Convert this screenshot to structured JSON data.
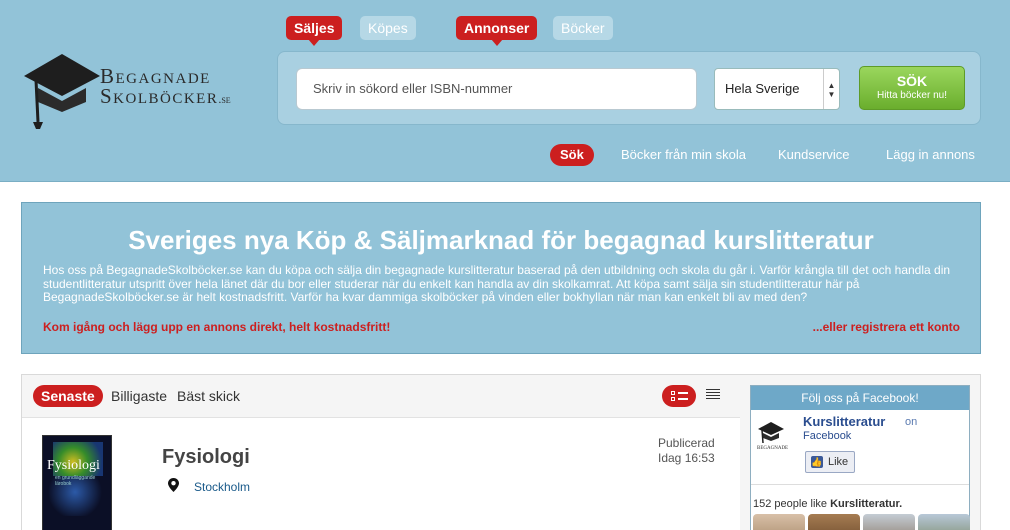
{
  "header": {
    "logo": {
      "line1": "Begagnade",
      "line2": "Skolböcker",
      "tld": ".se"
    },
    "mode_tabs": [
      {
        "label": "Säljes",
        "active": true
      },
      {
        "label": "Köpes",
        "active": false
      },
      {
        "label": "Annonser",
        "active": true
      },
      {
        "label": "Böcker",
        "active": false
      }
    ],
    "search": {
      "placeholder": "Skriv in sökord eller ISBN-nummer",
      "region": "Hela Sverige",
      "button_label": "SÖK",
      "button_sublabel": "Hitta böcker nu!"
    },
    "nav": [
      {
        "label": "Sök",
        "active": true
      },
      {
        "label": "Böcker från min skola",
        "active": false
      },
      {
        "label": "Kundservice",
        "active": false
      },
      {
        "label": "Lägg in annons",
        "active": false
      }
    ]
  },
  "banner": {
    "title": "Sveriges nya Köp & Säljmarknad för begagnad kurslitteratur",
    "description": "Hos oss på BegagnadeSkolböcker.se kan du köpa och sälja din begagnade kurslitteratur baserad på den utbildning och skola du går i. Varför krångla till det och handla din studentlitteratur utspritt över hela länet där du bor eller studerar när du enkelt kan handla av din skolkamrat. Att köpa samt sälja sin studentlitteratur här på BegagnadeSkolböcker.se är helt kostnadsfritt. Varför ha kvar dammiga skolböcker på vinden eller bokhyllan när man kan enkelt bli av med den?",
    "cta_left": "Kom igång och lägg upp en annons direkt, helt kostnadsfritt!",
    "cta_right": "...eller registrera ett konto"
  },
  "listing": {
    "sort_tabs": [
      {
        "label": "Senaste",
        "active": true
      },
      {
        "label": "Billigaste",
        "active": false
      },
      {
        "label": "Bäst skick",
        "active": false
      }
    ],
    "items": [
      {
        "cover_title": "Fysiologi",
        "cover_subtitle": "en grundläggande lärobok",
        "title": "Fysiologi",
        "location": "Stockholm",
        "published_label": "Publicerad",
        "published_time": "Idag 16:53"
      }
    ]
  },
  "facebook": {
    "header": "Följ oss på Facebook!",
    "logo_text": "BEGAGNADE",
    "page_name": "Kurslitteratur",
    "on_label": "on",
    "platform": "Facebook",
    "like_label": "Like",
    "like_count_text": "152 people like",
    "like_count_name": "Kurslitteratur."
  },
  "colors": {
    "header_bg": "#92c3d8",
    "accent_red": "#cc1f1f",
    "button_green": "#7dc243",
    "facebook_blue": "#3b5998"
  }
}
